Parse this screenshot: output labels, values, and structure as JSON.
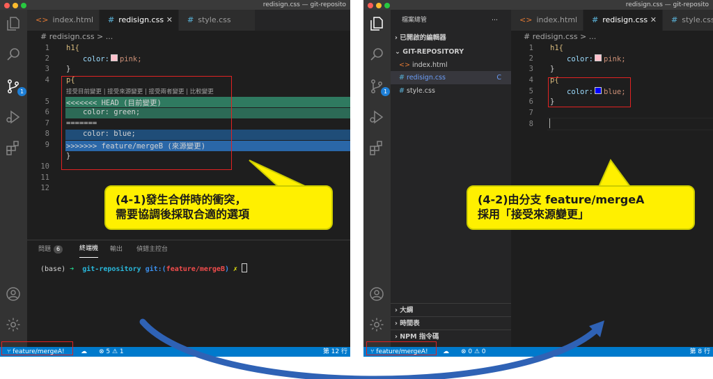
{
  "left": {
    "window_title": "redisign.css — git-reposito",
    "tabs": [
      {
        "label": "index.html",
        "icon": "html-file-icon"
      },
      {
        "label": "redisign.css",
        "icon": "css-file-icon",
        "close": "✕"
      },
      {
        "label": "style.css",
        "icon": "css-file-icon"
      }
    ],
    "breadcrumb": "# redisign.css > ...",
    "line_numbers": [
      "1",
      "2",
      "3",
      "4",
      "5",
      "6",
      "7",
      "8",
      "9",
      "10",
      "11",
      "12"
    ],
    "code": {
      "l1": "h1{",
      "l2_prop": "color:",
      "l2_val": "pink;",
      "l3": "}",
      "l4": "p{",
      "codelens": "接受目前變更 | 接受來源變更 | 接受兩者變更 | 比較變更",
      "l5": "<<<<<<< HEAD (目前變更)",
      "l6": "color: green;",
      "l7": "=======",
      "l8": "color: blue;",
      "l9": ">>>>>>> feature/mergeB (來源變更)",
      "l10": "}"
    },
    "panel": {
      "problems_label": "問題",
      "problems_count": "6",
      "terminal_label": "終端機",
      "output_label": "輸出",
      "debug_label": "偵錯主控台"
    },
    "terminal": {
      "base": "(base)",
      "arrow": "➜",
      "repo": "git-repository",
      "git": "git:(",
      "branch": "feature/mergeB",
      "close": ")",
      "x": "✗"
    },
    "status": {
      "branch": "feature/mergeA!",
      "errors": "⊗ 5 ⚠ 1",
      "position": "第 12 行"
    },
    "activity_badge": "1",
    "callout_line1": "(4-1)發生合併時的衝突，",
    "callout_line2": "需要協調後採取合適的選項"
  },
  "right": {
    "window_title": "redisign.css — git-reposito",
    "sidebar": {
      "title": "檔案總管",
      "more": "···",
      "open_editors": "已開啟的編輯器",
      "repo": "GIT-REPOSITORY",
      "files": [
        {
          "name": "index.html",
          "icon": "html-file-icon",
          "status": ""
        },
        {
          "name": "redisign.css",
          "icon": "css-file-icon",
          "status": "C"
        },
        {
          "name": "style.css",
          "icon": "css-file-icon",
          "status": ""
        }
      ],
      "outline": "大綱",
      "timeline": "時間表",
      "npm": "NPM 指令碼"
    },
    "tabs": [
      {
        "label": "index.html",
        "icon": "html-file-icon"
      },
      {
        "label": "redisign.css",
        "icon": "css-file-icon",
        "close": "✕"
      },
      {
        "label": "style.css",
        "icon": "css-file-icon"
      }
    ],
    "breadcrumb": "# redisign.css > ...",
    "line_numbers": [
      "1",
      "2",
      "3",
      "4",
      "5",
      "6",
      "7",
      "8"
    ],
    "code": {
      "l1": "h1{",
      "l2_prop": "color:",
      "l2_val": "pink;",
      "l3": "}",
      "l4": "p{",
      "l5_prop": "color:",
      "l5_val": "blue;",
      "l6": "}"
    },
    "status": {
      "branch": "feature/mergeA!",
      "errors": "⊗ 0 ⚠ 0",
      "position": "第 8 行"
    },
    "activity_badge": "1",
    "callout_line1": "(4-2)由分支 feature/mergeA",
    "callout_line2": "採用「接受來源變更」"
  },
  "colors": {
    "current_change_bg": "#2c6a56",
    "current_header_bg": "#2f7a60",
    "incoming_change_bg": "#1f4d78",
    "incoming_header_bg": "#2a67a8",
    "statusbar": "#007acc",
    "callout": "#fff000",
    "annotation_red": "#e22222",
    "arrow": "#2f62b5",
    "swatch_pink": "#ffc0cb",
    "swatch_blue": "#0000ff"
  }
}
